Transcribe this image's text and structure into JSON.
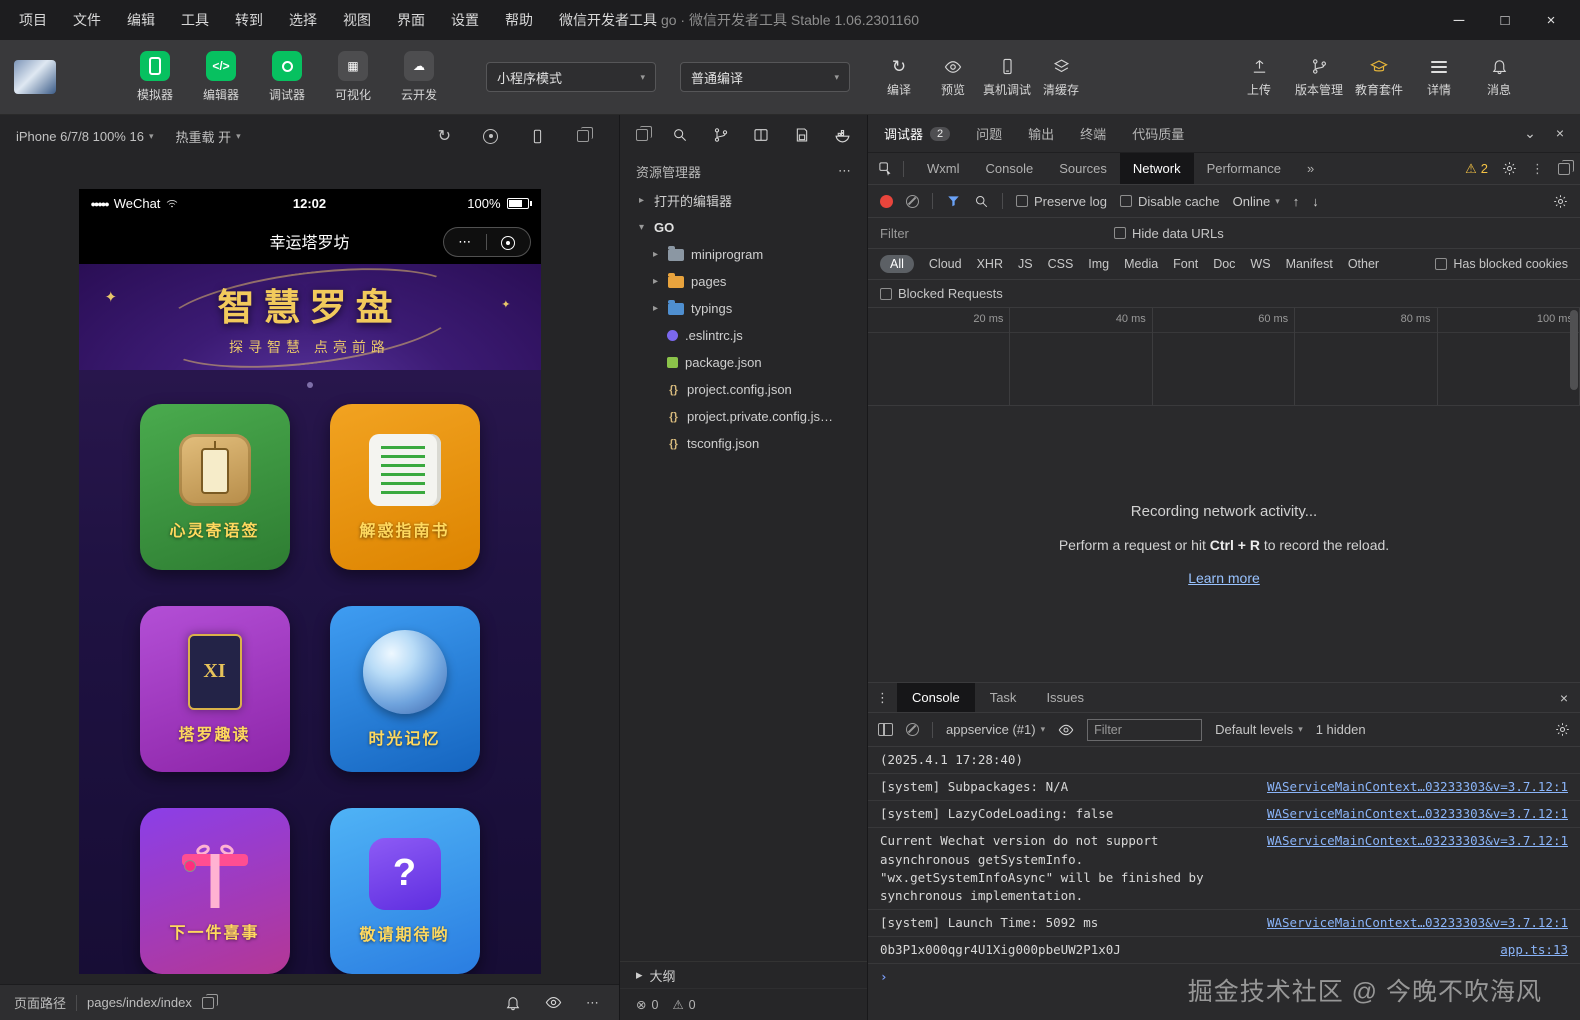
{
  "icons": {
    "caret_down": "▾",
    "caret_right": "▸",
    "collapse": "⌄",
    "chevrons": "»",
    "close": "×",
    "minimize": "─",
    "maximize": "□",
    "more_h": "⋯",
    "more_v": "⋮",
    "warning": "⚠",
    "record": "●",
    "signal": "●●●●●",
    "arrow_up": "↑",
    "arrow_down": "↓",
    "refresh": "↻",
    "sparkle": "✦",
    "prompt": "›",
    "code": "</>",
    "grid": "▦",
    "cloud": "☁",
    "braces": "{}",
    "error_zero_icon": "⊗",
    "warn_zero_icon": "⚠"
  },
  "titlebar": {
    "menus": [
      "项目",
      "文件",
      "编辑",
      "工具",
      "转到",
      "选择",
      "视图",
      "界面",
      "设置",
      "帮助",
      "微信开发者工具"
    ],
    "title": "go · 微信开发者工具 Stable 1.06.2301160"
  },
  "toolbar": {
    "buttons": [
      {
        "label": "模拟器"
      },
      {
        "label": "编辑器"
      },
      {
        "label": "调试器"
      },
      {
        "label": "可视化"
      },
      {
        "label": "云开发"
      }
    ],
    "mode_select": "小程序模式",
    "compile_select": "普通编译",
    "compile": "编译",
    "preview": "预览",
    "remote_debug": "真机调试",
    "clear_cache": "清缓存",
    "upload": "上传",
    "version": "版本管理",
    "edu": "教育套件",
    "details": "详情",
    "messages": "消息"
  },
  "simulator": {
    "device": "iPhone 6/7/8 100% 16",
    "hot_reload": "热重载 开",
    "statusbar": {
      "carrier": "WeChat",
      "time": "12:02",
      "battery": "100%"
    },
    "nav_title": "幸运塔罗坊",
    "banner": {
      "title": "智慧罗盘",
      "subtitle": "探寻智慧 点亮前路"
    },
    "cards": [
      {
        "label": "心灵寄语签"
      },
      {
        "label": "解惑指南书"
      },
      {
        "label": "塔罗趣读",
        "icon_text": "XI"
      },
      {
        "label": "时光记忆"
      },
      {
        "label": "下一件喜事"
      },
      {
        "label": "敬请期待哟",
        "icon_text": "?"
      }
    ],
    "bottombar": {
      "path_label": "页面路径",
      "path": "pages/index/index"
    }
  },
  "explorer": {
    "title": "资源管理器",
    "open_editors": "打开的编辑器",
    "project": "GO",
    "tree": [
      {
        "label": "miniprogram"
      },
      {
        "label": "pages"
      },
      {
        "label": "typings"
      },
      {
        "label": ".eslintrc.js"
      },
      {
        "label": "package.json"
      },
      {
        "label": "project.config.json"
      },
      {
        "label": "project.private.config.js…"
      },
      {
        "label": "tsconfig.json"
      }
    ],
    "outline": "大纲",
    "errors": "0",
    "warnings": "0"
  },
  "panel_tabs": {
    "items": [
      {
        "label": "调试器",
        "badge": "2"
      },
      {
        "label": "问题"
      },
      {
        "label": "输出"
      },
      {
        "label": "终端"
      },
      {
        "label": "代码质量"
      }
    ]
  },
  "devtools": {
    "tabs": [
      "Wxml",
      "Console",
      "Sources",
      "Network",
      "Performance"
    ],
    "warning_count": "2",
    "network": {
      "preserve_log": "Preserve log",
      "disable_cache": "Disable cache",
      "throttling": "Online",
      "filter_placeholder": "Filter",
      "hide_data_urls": "Hide data URLs",
      "filters": [
        "All",
        "Cloud",
        "XHR",
        "JS",
        "CSS",
        "Img",
        "Media",
        "Font",
        "Doc",
        "WS",
        "Manifest",
        "Other"
      ],
      "has_blocked_cookies": "Has blocked cookies",
      "blocked_requests": "Blocked Requests",
      "ticks": [
        "20 ms",
        "40 ms",
        "60 ms",
        "80 ms",
        "100 ms"
      ],
      "empty_title": "Recording network activity...",
      "empty_hint_pre": "Perform a request or hit ",
      "empty_hint_key": "Ctrl + R",
      "empty_hint_post": " to record the reload.",
      "learn_more": "Learn more"
    }
  },
  "console": {
    "tabs": [
      "Console",
      "Task",
      "Issues"
    ],
    "context": "appservice (#1)",
    "filter_placeholder": "Filter",
    "levels": "Default levels",
    "hidden": "1 hidden",
    "messages": [
      {
        "text": "(2025.4.1 17:28:40)",
        "link": ""
      },
      {
        "text": "[system] Subpackages: N/A",
        "link": "WAServiceMainContext…03233303&v=3.7.12:1"
      },
      {
        "text": "[system] LazyCodeLoading: false",
        "link": "WAServiceMainContext…03233303&v=3.7.12:1"
      },
      {
        "text": "Current Wechat version do not support asynchronous getSystemInfo. \"wx.getSystemInfoAsync\" will be finished by synchronous implementation.",
        "link": "WAServiceMainContext…03233303&v=3.7.12:1"
      },
      {
        "text": "[system] Launch Time: 5092 ms",
        "link": "WAServiceMainContext…03233303&v=3.7.12:1"
      },
      {
        "text": "0b3P1x000qgr4U1Xig000pbeUW2P1x0J",
        "link": "app.ts:13"
      }
    ]
  },
  "watermark": "掘金技术社区 @ 今晚不吹海风"
}
